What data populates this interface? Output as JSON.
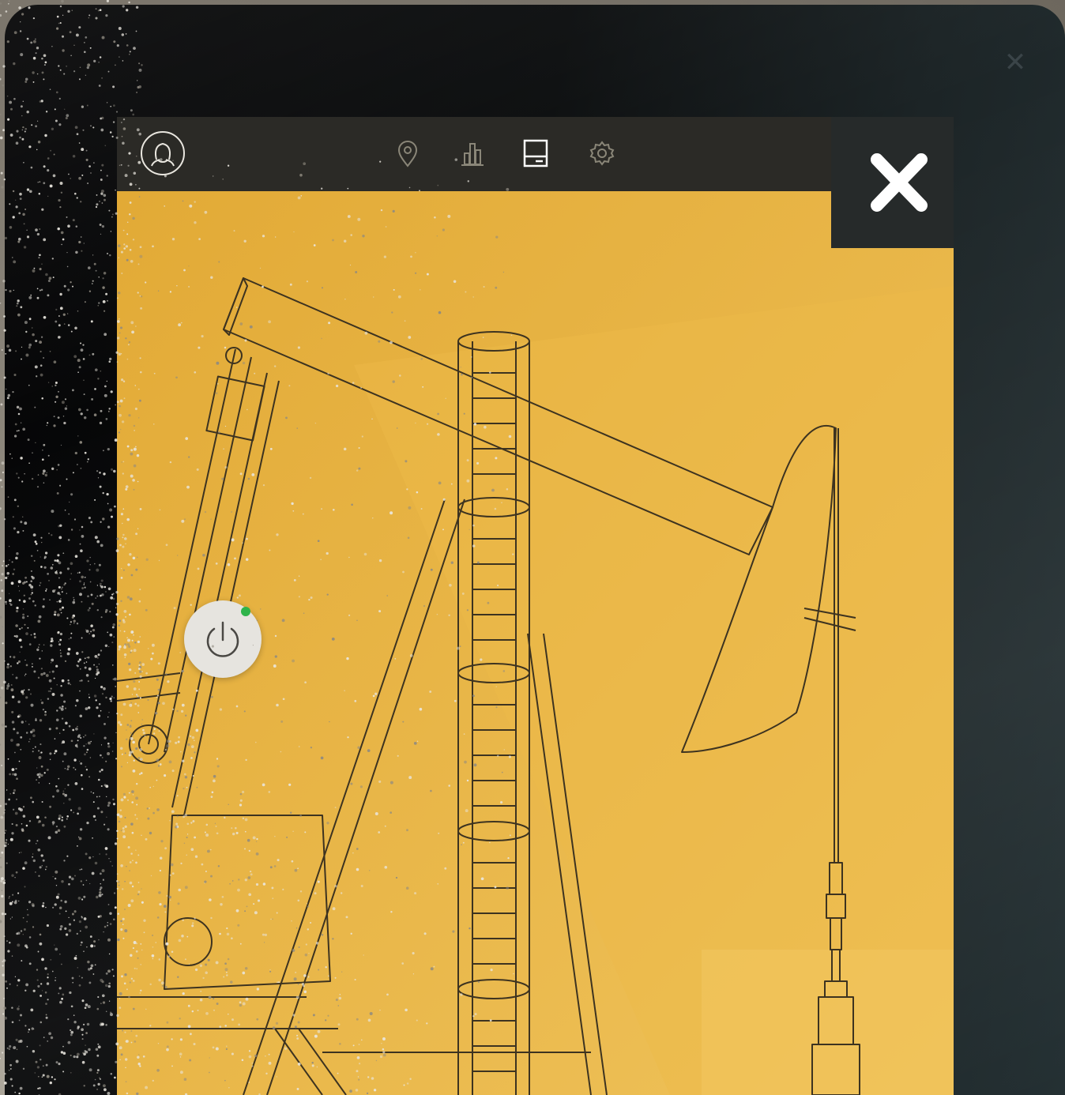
{
  "app": {
    "toolbar": {
      "tabs": [
        {
          "icon": "location-pin-icon",
          "active": false
        },
        {
          "icon": "bar-chart-icon",
          "active": false
        },
        {
          "icon": "panel-icon",
          "active": true
        },
        {
          "icon": "gear-icon",
          "active": false
        }
      ]
    },
    "power": {
      "status": "on",
      "status_color": "#2fb34a"
    },
    "colors": {
      "accent": "#e8b23e",
      "toolbar": "#2b2a26",
      "line": "#3d3320",
      "icon_active": "#ffffff",
      "icon_inactive": "#8a8678"
    },
    "illustration": "pumpjack-icon",
    "bezel": {
      "close_icon": "close-icon"
    }
  }
}
